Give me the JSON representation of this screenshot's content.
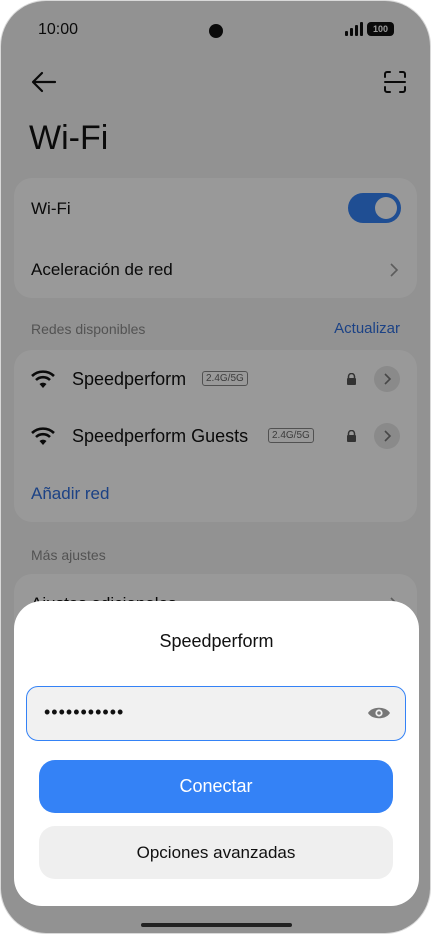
{
  "status_bar": {
    "time": "10:00",
    "battery": "100"
  },
  "header": {
    "title": "Wi-Fi"
  },
  "wifi_card": {
    "wifi_label": "Wi-Fi",
    "wifi_enabled": true,
    "acceleration_label": "Aceleración de red"
  },
  "networks_section": {
    "label": "Redes disponibles",
    "refresh_label": "Actualizar",
    "items": [
      {
        "name": "Speedperform",
        "band": "2.4G/5G",
        "secured": true
      },
      {
        "name": "Speedperform Guests",
        "band": "2.4G/5G",
        "secured": true
      }
    ],
    "add_label": "Añadir red"
  },
  "more_section": {
    "label": "Más ajustes",
    "first_item_partial": "Ajustes adicionales"
  },
  "dialog": {
    "title": "Speedperform",
    "password_value": "•••••••••••",
    "connect_label": "Conectar",
    "advanced_label": "Opciones avanzadas"
  },
  "colors": {
    "accent": "#3482f6",
    "link": "#2f6fde"
  },
  "icons": [
    "back-arrow-icon",
    "scan-icon",
    "wifi-icon",
    "lock-icon",
    "chevron-right-icon",
    "eye-icon"
  ]
}
